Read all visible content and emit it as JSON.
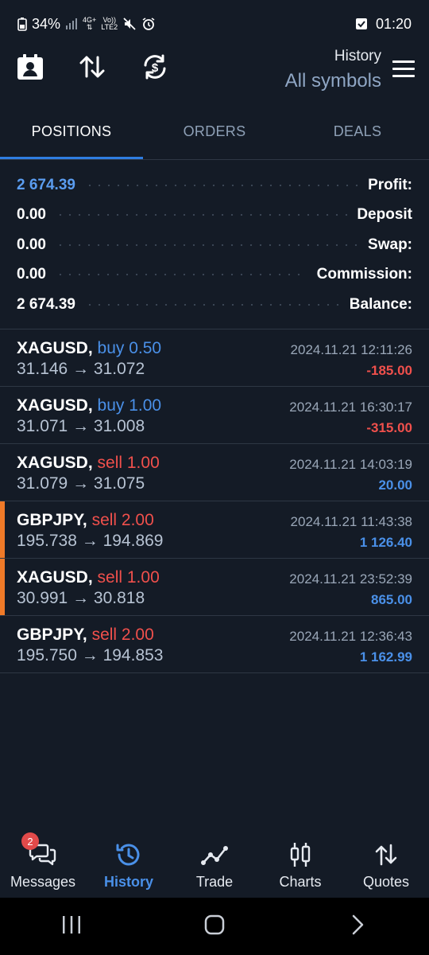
{
  "status_bar": {
    "battery": "34%",
    "network_top": "4G+",
    "network_bottom": "LTE2",
    "volte_top": "Vo))",
    "time": "01:20"
  },
  "toolbar": {
    "title": "History",
    "subtitle": "All symbols"
  },
  "tabs": [
    {
      "label": "POSITIONS",
      "active": true
    },
    {
      "label": "ORDERS",
      "active": false
    },
    {
      "label": "DEALS",
      "active": false
    }
  ],
  "summary": [
    {
      "value": "2 674.39",
      "label": "Profit:"
    },
    {
      "value": "0.00",
      "label": "Deposit"
    },
    {
      "value": "0.00",
      "label": "Swap:"
    },
    {
      "value": "0.00",
      "label": "Commission:"
    },
    {
      "value": "2 674.39",
      "label": "Balance:"
    }
  ],
  "deals": [
    {
      "symbol": "XAGUSD,",
      "side": "buy 0.50",
      "direction": "buy",
      "prices": "31.146 → 31.072",
      "time": "2024.11.21 12:11:26",
      "pnl": "-185.00",
      "pnl_sign": "neg",
      "marker": false
    },
    {
      "symbol": "XAGUSD,",
      "side": "buy 1.00",
      "direction": "buy",
      "prices": "31.071 → 31.008",
      "time": "2024.11.21 16:30:17",
      "pnl": "-315.00",
      "pnl_sign": "neg",
      "marker": false
    },
    {
      "symbol": "XAGUSD,",
      "side": "sell 1.00",
      "direction": "sell",
      "prices": "31.079 → 31.075",
      "time": "2024.11.21 14:03:19",
      "pnl": "20.00",
      "pnl_sign": "pos",
      "marker": false
    },
    {
      "symbol": "GBPJPY,",
      "side": "sell 2.00",
      "direction": "sell",
      "prices": "195.738 → 194.869",
      "time": "2024.11.21 11:43:38",
      "pnl": "1 126.40",
      "pnl_sign": "pos",
      "marker": true
    },
    {
      "symbol": "XAGUSD,",
      "side": "sell 1.00",
      "direction": "sell",
      "prices": "30.991 → 30.818",
      "time": "2024.11.21 23:52:39",
      "pnl": "865.00",
      "pnl_sign": "pos",
      "marker": true
    },
    {
      "symbol": "GBPJPY,",
      "side": "sell 2.00",
      "direction": "sell",
      "prices": "195.750 → 194.853",
      "time": "2024.11.21 12:36:43",
      "pnl": "1 162.99",
      "pnl_sign": "pos",
      "marker": false
    }
  ],
  "bottom_nav": [
    {
      "label": "Messages",
      "icon": "messages-icon",
      "badge": "2",
      "active": false
    },
    {
      "label": "History",
      "icon": "history-icon",
      "active": true
    },
    {
      "label": "Trade",
      "icon": "trade-icon",
      "active": false
    },
    {
      "label": "Charts",
      "icon": "charts-icon",
      "active": false
    },
    {
      "label": "Quotes",
      "icon": "quotes-icon",
      "active": false
    }
  ],
  "colors": {
    "background": "#141b26",
    "accent_blue": "#4a90e8",
    "loss_red": "#f0504c",
    "marker_orange": "#f07a28"
  }
}
